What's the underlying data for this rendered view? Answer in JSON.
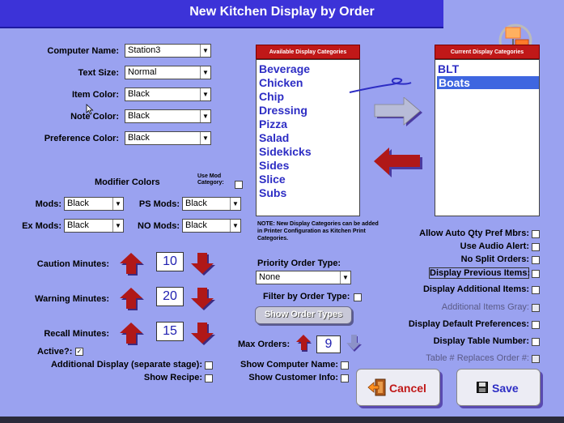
{
  "window": {
    "title": "New Kitchen Display by Order"
  },
  "form": {
    "computer_name": {
      "label": "Computer Name:",
      "value": "Station3"
    },
    "text_size": {
      "label": "Text Size:",
      "value": "Normal"
    },
    "item_color": {
      "label": "Item Color:",
      "value": "Black"
    },
    "note_color": {
      "label": "Note Color:",
      "value": "Black"
    },
    "preference_color": {
      "label": "Preference Color:",
      "value": "Black"
    }
  },
  "modifiers": {
    "title": "Modifier Colors",
    "use_mod_category": "Use Mod Category:",
    "mods": {
      "label": "Mods:",
      "value": "Black"
    },
    "ps_mods": {
      "label": "PS Mods:",
      "value": "Black"
    },
    "ex_mods": {
      "label": "Ex Mods:",
      "value": "Black"
    },
    "no_mods": {
      "label": "NO Mods:",
      "value": "Black"
    }
  },
  "minutes": {
    "caution": {
      "label": "Caution Minutes:",
      "value": "10"
    },
    "warning": {
      "label": "Warning Minutes:",
      "value": "20"
    },
    "recall": {
      "label": "Recall Minutes:",
      "value": "15"
    }
  },
  "checks_left": {
    "active": {
      "label": "Active?:",
      "checked": true
    },
    "additional_display": {
      "label": "Additional Display (separate stage):",
      "checked": false
    },
    "show_recipe": {
      "label": "Show Recipe:",
      "checked": false
    }
  },
  "available": {
    "header": "Available Display Categories",
    "items": [
      "Beverage",
      "Chicken",
      "Chip",
      "Dressing",
      "Pizza",
      "Salad",
      "Sidekicks",
      "Sides",
      "Slice",
      "Subs"
    ]
  },
  "current": {
    "header": "Current Display Categories",
    "items": [
      "BLT",
      "Boats"
    ],
    "selected": "Boats"
  },
  "note": "NOTE: New Display Categories can be added in Printer Configuration as Kitchen Print Categories.",
  "priority": {
    "label": "Priority Order Type:",
    "value": "None"
  },
  "filter_by_order_type": {
    "label": "Filter by Order Type:",
    "checked": false
  },
  "show_order_types_button": "Show Order Types",
  "max_orders": {
    "label": "Max Orders:",
    "value": "9"
  },
  "show_computer_name": {
    "label": "Show Computer Name:",
    "checked": false
  },
  "show_customer_info": {
    "label": "Show Customer Info:",
    "checked": false
  },
  "right_options": [
    {
      "label": "Allow Auto Qty Pref Mbrs:",
      "checked": false,
      "enabled": true
    },
    {
      "label": "Use Audio Alert:",
      "checked": false,
      "enabled": true
    },
    {
      "label": "No Split Orders:",
      "checked": false,
      "enabled": true
    },
    {
      "label": "Display Previous Items:",
      "checked": false,
      "enabled": true
    },
    {
      "label": "Display Additional Items:",
      "checked": false,
      "enabled": true
    },
    {
      "label": "Additional Items Gray:",
      "checked": false,
      "enabled": false
    },
    {
      "label": "Display Default Preferences:",
      "checked": false,
      "enabled": true
    },
    {
      "label": "Display Table Number:",
      "checked": false,
      "enabled": true
    },
    {
      "label": "Table # Replaces Order #:",
      "checked": false,
      "enabled": false
    }
  ],
  "buttons": {
    "cancel": "Cancel",
    "save": "Save"
  },
  "colors": {
    "background": "#9aa2f0",
    "titlebar": "#3c33d8",
    "arrow_red": "#b01818",
    "list_text": "#2d2dc4",
    "list_header": "#c01818"
  },
  "icons": [
    "up-arrow-icon",
    "down-arrow-icon",
    "right-arrow-icon",
    "left-arrow-icon",
    "exit-door-icon",
    "floppy-disk-icon",
    "monitor-network-icon",
    "mouse-cursor-icon"
  ]
}
